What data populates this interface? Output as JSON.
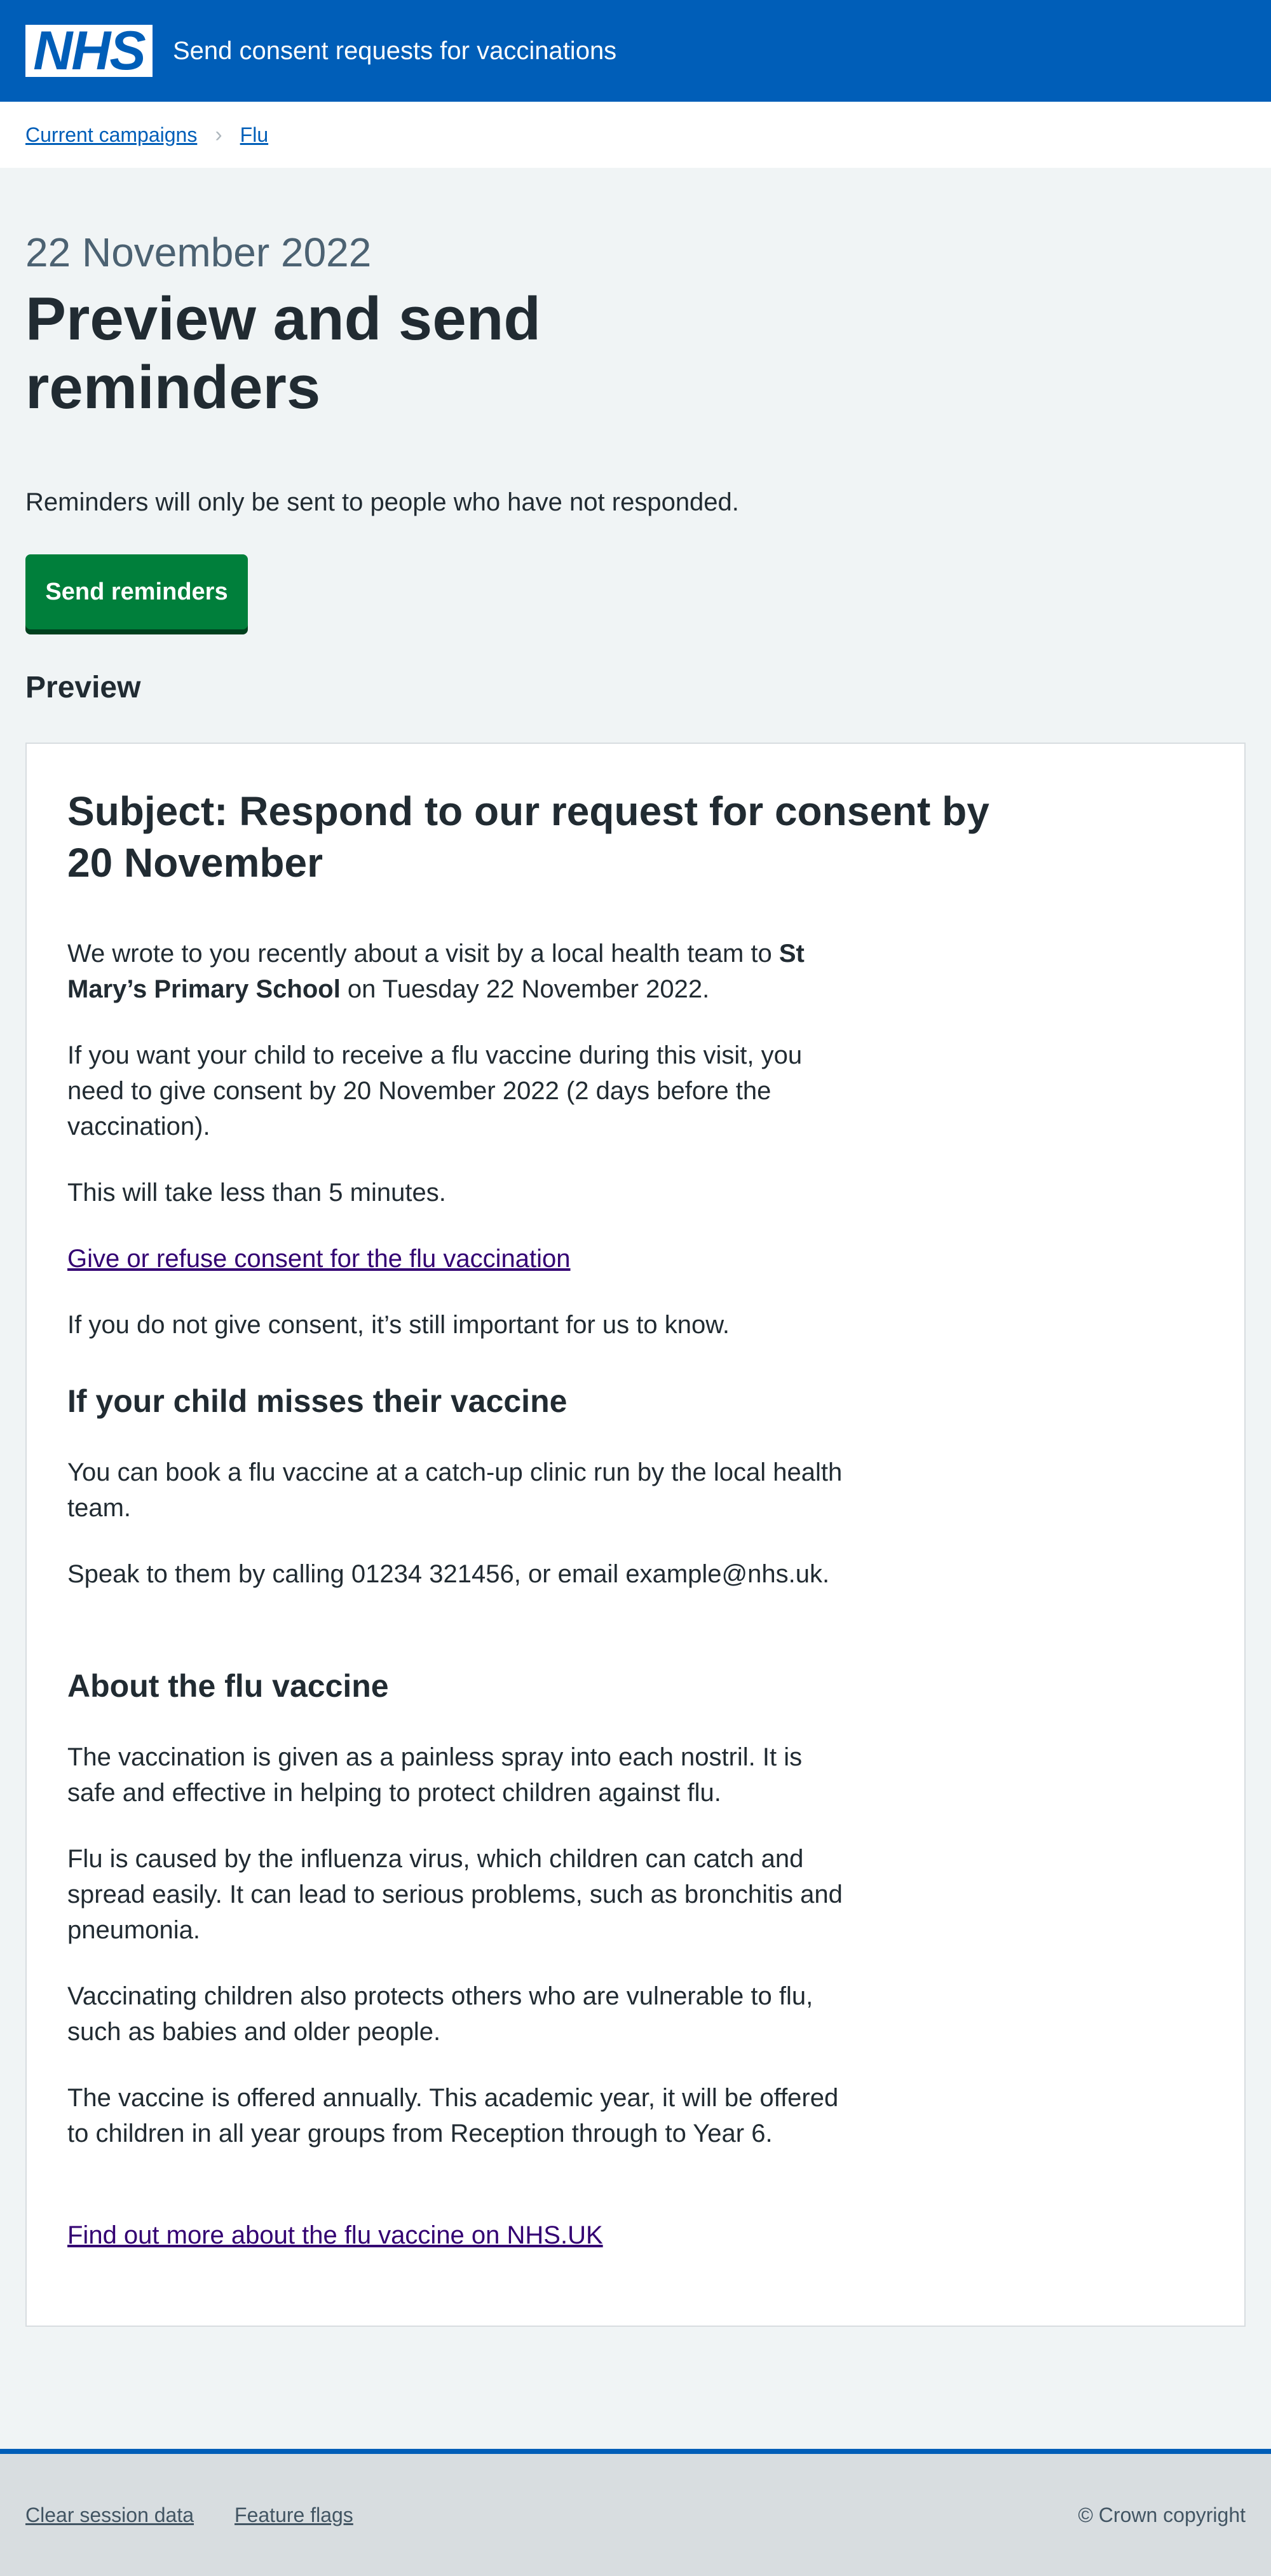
{
  "header": {
    "logo_text": "NHS",
    "service_name": "Send consent requests for vaccinations",
    "colors": {
      "nhs_blue": "#005eb8"
    }
  },
  "breadcrumb": {
    "items": [
      "Current campaigns",
      "Flu"
    ]
  },
  "page": {
    "caption": "22 November 2022",
    "title": "Preview and send reminders",
    "intro": "Reminders will only be sent to people who have not responded.",
    "send_button": "Send reminders",
    "preview_heading": "Preview"
  },
  "email": {
    "subject": "Subject: Respond to our request for consent by 20 November",
    "p1_a": "We wrote to you recently about a visit by a local health team to ",
    "p1_school": "St Mary’s Primary School",
    "p1_b": " on Tuesday 22 November 2022.",
    "p2": "If you want your child to receive a flu vaccine during this visit, you need to give consent by 20 November 2022 (2 days before the vaccination).",
    "p3": "This will take less than 5 minutes.",
    "consent_link": "Give or refuse consent for the flu vaccination",
    "p4": "If you do not give consent, it’s still important for us to know.",
    "h_misses": "If your child misses their vaccine",
    "p5": "You can book a flu vaccine at a catch-up clinic run by the local health team.",
    "p6": "Speak to them by calling 01234 321456, or email example@nhs.uk.",
    "h_about": "About the flu vaccine",
    "p7": "The vaccination is given as a painless spray into each nostril. It is safe and effective in helping to protect children against flu.",
    "p8": "Flu is caused by the influenza virus, which children can catch and spread easily. It can lead to serious problems, such as bronchitis and pneumonia.",
    "p9": "Vaccinating children also protects others who are vulnerable to flu, such as babies and older people.",
    "p10": "The vaccine is offered annually. This academic year, it will be offered to children in all year groups from Reception through to Year 6.",
    "more_link": "Find out more about the flu vaccine on NHS.UK"
  },
  "footer": {
    "links": [
      "Clear session data",
      "Feature flags"
    ],
    "copyright": "© Crown copyright"
  }
}
